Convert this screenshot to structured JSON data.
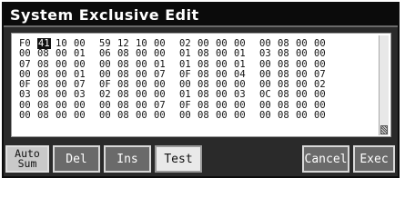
{
  "window": {
    "title": "System Exclusive Edit"
  },
  "hex": {
    "rows": [
      [
        "F0",
        "41",
        "10",
        "00",
        "59",
        "12",
        "10",
        "00",
        "02",
        "00",
        "00",
        "00",
        "00",
        "08",
        "00",
        "00"
      ],
      [
        "00",
        "08",
        "00",
        "01",
        "06",
        "08",
        "00",
        "00",
        "01",
        "08",
        "00",
        "01",
        "03",
        "08",
        "00",
        "00"
      ],
      [
        "07",
        "08",
        "00",
        "00",
        "00",
        "08",
        "00",
        "01",
        "01",
        "08",
        "00",
        "01",
        "00",
        "08",
        "00",
        "00"
      ],
      [
        "00",
        "08",
        "00",
        "01",
        "00",
        "08",
        "00",
        "07",
        "0F",
        "08",
        "00",
        "04",
        "00",
        "08",
        "00",
        "07"
      ],
      [
        "0F",
        "08",
        "00",
        "07",
        "0F",
        "08",
        "00",
        "00",
        "00",
        "08",
        "00",
        "00",
        "00",
        "08",
        "00",
        "02"
      ],
      [
        "03",
        "08",
        "00",
        "03",
        "02",
        "08",
        "00",
        "00",
        "01",
        "08",
        "00",
        "03",
        "0C",
        "08",
        "00",
        "00"
      ],
      [
        "00",
        "08",
        "00",
        "00",
        "00",
        "08",
        "00",
        "07",
        "0F",
        "08",
        "00",
        "00",
        "00",
        "08",
        "00",
        "00"
      ],
      [
        "00",
        "08",
        "00",
        "00",
        "00",
        "08",
        "00",
        "00",
        "00",
        "08",
        "00",
        "00",
        "00",
        "08",
        "00",
        "00"
      ]
    ],
    "selected": {
      "row": 0,
      "col": 1
    }
  },
  "buttons": {
    "auto_sum_line1": "Auto",
    "auto_sum_line2": "Sum",
    "del": "Del",
    "ins": "Ins",
    "test": "Test",
    "cancel": "Cancel",
    "exec": "Exec"
  }
}
